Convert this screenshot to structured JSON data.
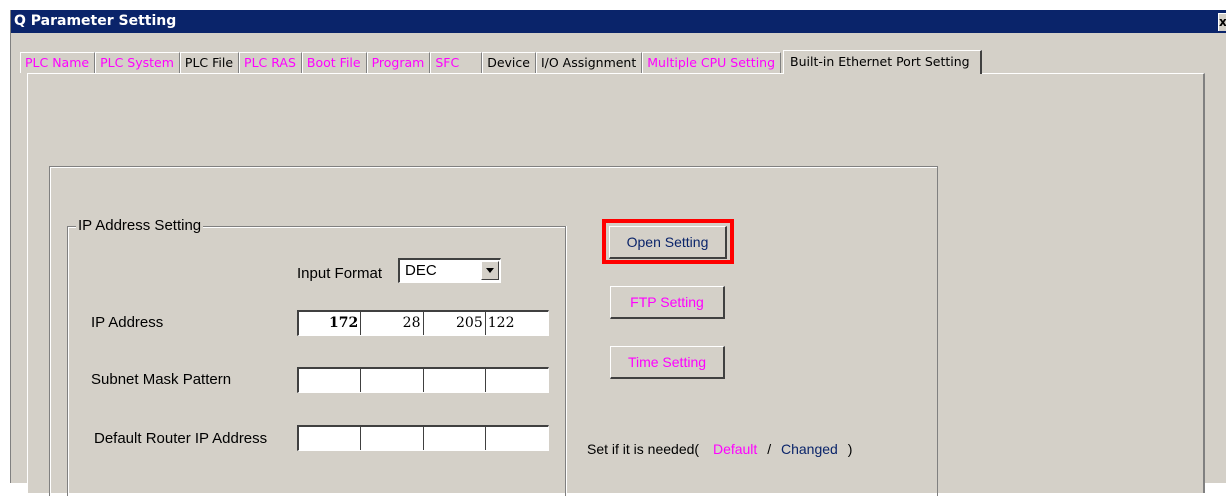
{
  "window": {
    "title": "Q Parameter Setting",
    "close_glyph": "x",
    "title_bar_color": "#0a246a",
    "face_color": "#d4d0c8"
  },
  "tabs": [
    {
      "label": "PLC Name",
      "style": "magenta"
    },
    {
      "label": "PLC System",
      "style": "magenta"
    },
    {
      "label": "PLC File",
      "style": "normal"
    },
    {
      "label": "PLC RAS",
      "style": "magenta"
    },
    {
      "label": "Boot File",
      "style": "magenta"
    },
    {
      "label": "Program",
      "style": "magenta"
    },
    {
      "label": "SFC",
      "style": "magenta"
    },
    {
      "label": "Device",
      "style": "normal"
    },
    {
      "label": "I/O Assignment",
      "style": "normal"
    },
    {
      "label": "Multiple CPU Setting",
      "style": "magenta"
    },
    {
      "label": "Built-in Ethernet Port Setting",
      "style": "active"
    }
  ],
  "ip_group": {
    "title": "IP Address Setting",
    "input_format_label": "Input Format",
    "input_format_value": "DEC",
    "ip_address_label": "IP Address",
    "ip_address": [
      "172",
      "28",
      "205",
      "122"
    ],
    "subnet_label": "Subnet Mask Pattern",
    "subnet_mask": [
      "",
      "",
      "",
      ""
    ],
    "router_label": "Default Router IP Address",
    "router_ip": [
      "",
      "",
      "",
      ""
    ]
  },
  "buttons": {
    "open_setting": "Open Setting",
    "ftp_setting": "FTP Setting",
    "time_setting": "Time Setting"
  },
  "note": {
    "prefix": "Set if it is needed(",
    "default": "Default",
    "slash": "/",
    "changed": "Changed",
    "suffix": ")"
  },
  "colors": {
    "highlight": "#ff0000",
    "default_text": "#ff00ff",
    "changed_text": "#0a246a"
  }
}
